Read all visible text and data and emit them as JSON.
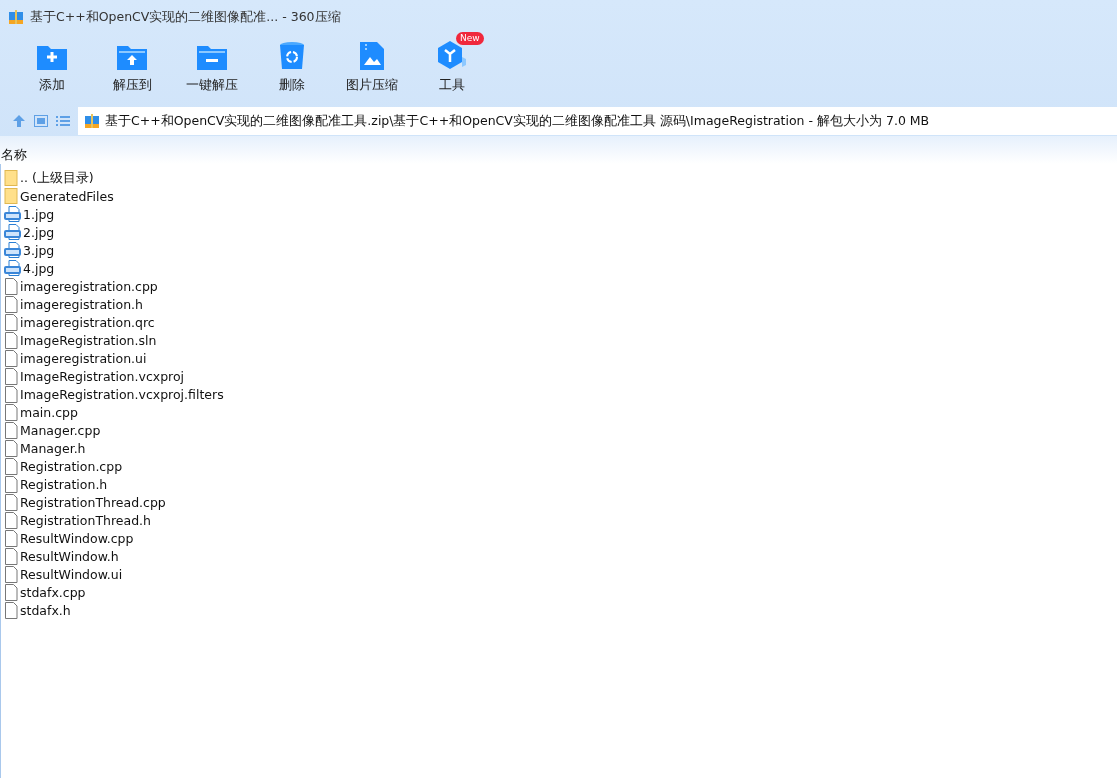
{
  "window": {
    "title": "基于C++和OpenCV实现的二维图像配准... - 360压缩"
  },
  "toolbar": [
    {
      "label": "添加",
      "kind": "add"
    },
    {
      "label": "解压到",
      "kind": "extract"
    },
    {
      "label": "一键解压",
      "kind": "onekey"
    },
    {
      "label": "删除",
      "kind": "delete"
    },
    {
      "label": "图片压缩",
      "kind": "image"
    },
    {
      "label": "工具",
      "kind": "tools",
      "badge": "New"
    }
  ],
  "address": {
    "path": "基于C++和OpenCV实现的二维图像配准工具.zip\\基于C++和OpenCV实现的二维图像配准工具 源码\\ImageRegistration - 解包大小为 7.0 MB"
  },
  "table": {
    "columns": [
      "名称"
    ],
    "rows": [
      {
        "name": ".. (上级目录)",
        "kind": "folder"
      },
      {
        "name": "GeneratedFiles",
        "kind": "folder"
      },
      {
        "name": "1.jpg",
        "kind": "image"
      },
      {
        "name": "2.jpg",
        "kind": "image"
      },
      {
        "name": "3.jpg",
        "kind": "image"
      },
      {
        "name": "4.jpg",
        "kind": "image"
      },
      {
        "name": "imageregistration.cpp",
        "kind": "file"
      },
      {
        "name": "imageregistration.h",
        "kind": "file"
      },
      {
        "name": "imageregistration.qrc",
        "kind": "file"
      },
      {
        "name": "ImageRegistration.sln",
        "kind": "file"
      },
      {
        "name": "imageregistration.ui",
        "kind": "file"
      },
      {
        "name": "ImageRegistration.vcxproj",
        "kind": "file"
      },
      {
        "name": "ImageRegistration.vcxproj.filters",
        "kind": "file"
      },
      {
        "name": "main.cpp",
        "kind": "file"
      },
      {
        "name": "Manager.cpp",
        "kind": "file"
      },
      {
        "name": "Manager.h",
        "kind": "file"
      },
      {
        "name": "Registration.cpp",
        "kind": "file"
      },
      {
        "name": "Registration.h",
        "kind": "file"
      },
      {
        "name": "RegistrationThread.cpp",
        "kind": "file"
      },
      {
        "name": "RegistrationThread.h",
        "kind": "file"
      },
      {
        "name": "ResultWindow.cpp",
        "kind": "file"
      },
      {
        "name": "ResultWindow.h",
        "kind": "file"
      },
      {
        "name": "ResultWindow.ui",
        "kind": "file"
      },
      {
        "name": "stdafx.cpp",
        "kind": "file"
      },
      {
        "name": "stdafx.h",
        "kind": "file"
      }
    ]
  }
}
